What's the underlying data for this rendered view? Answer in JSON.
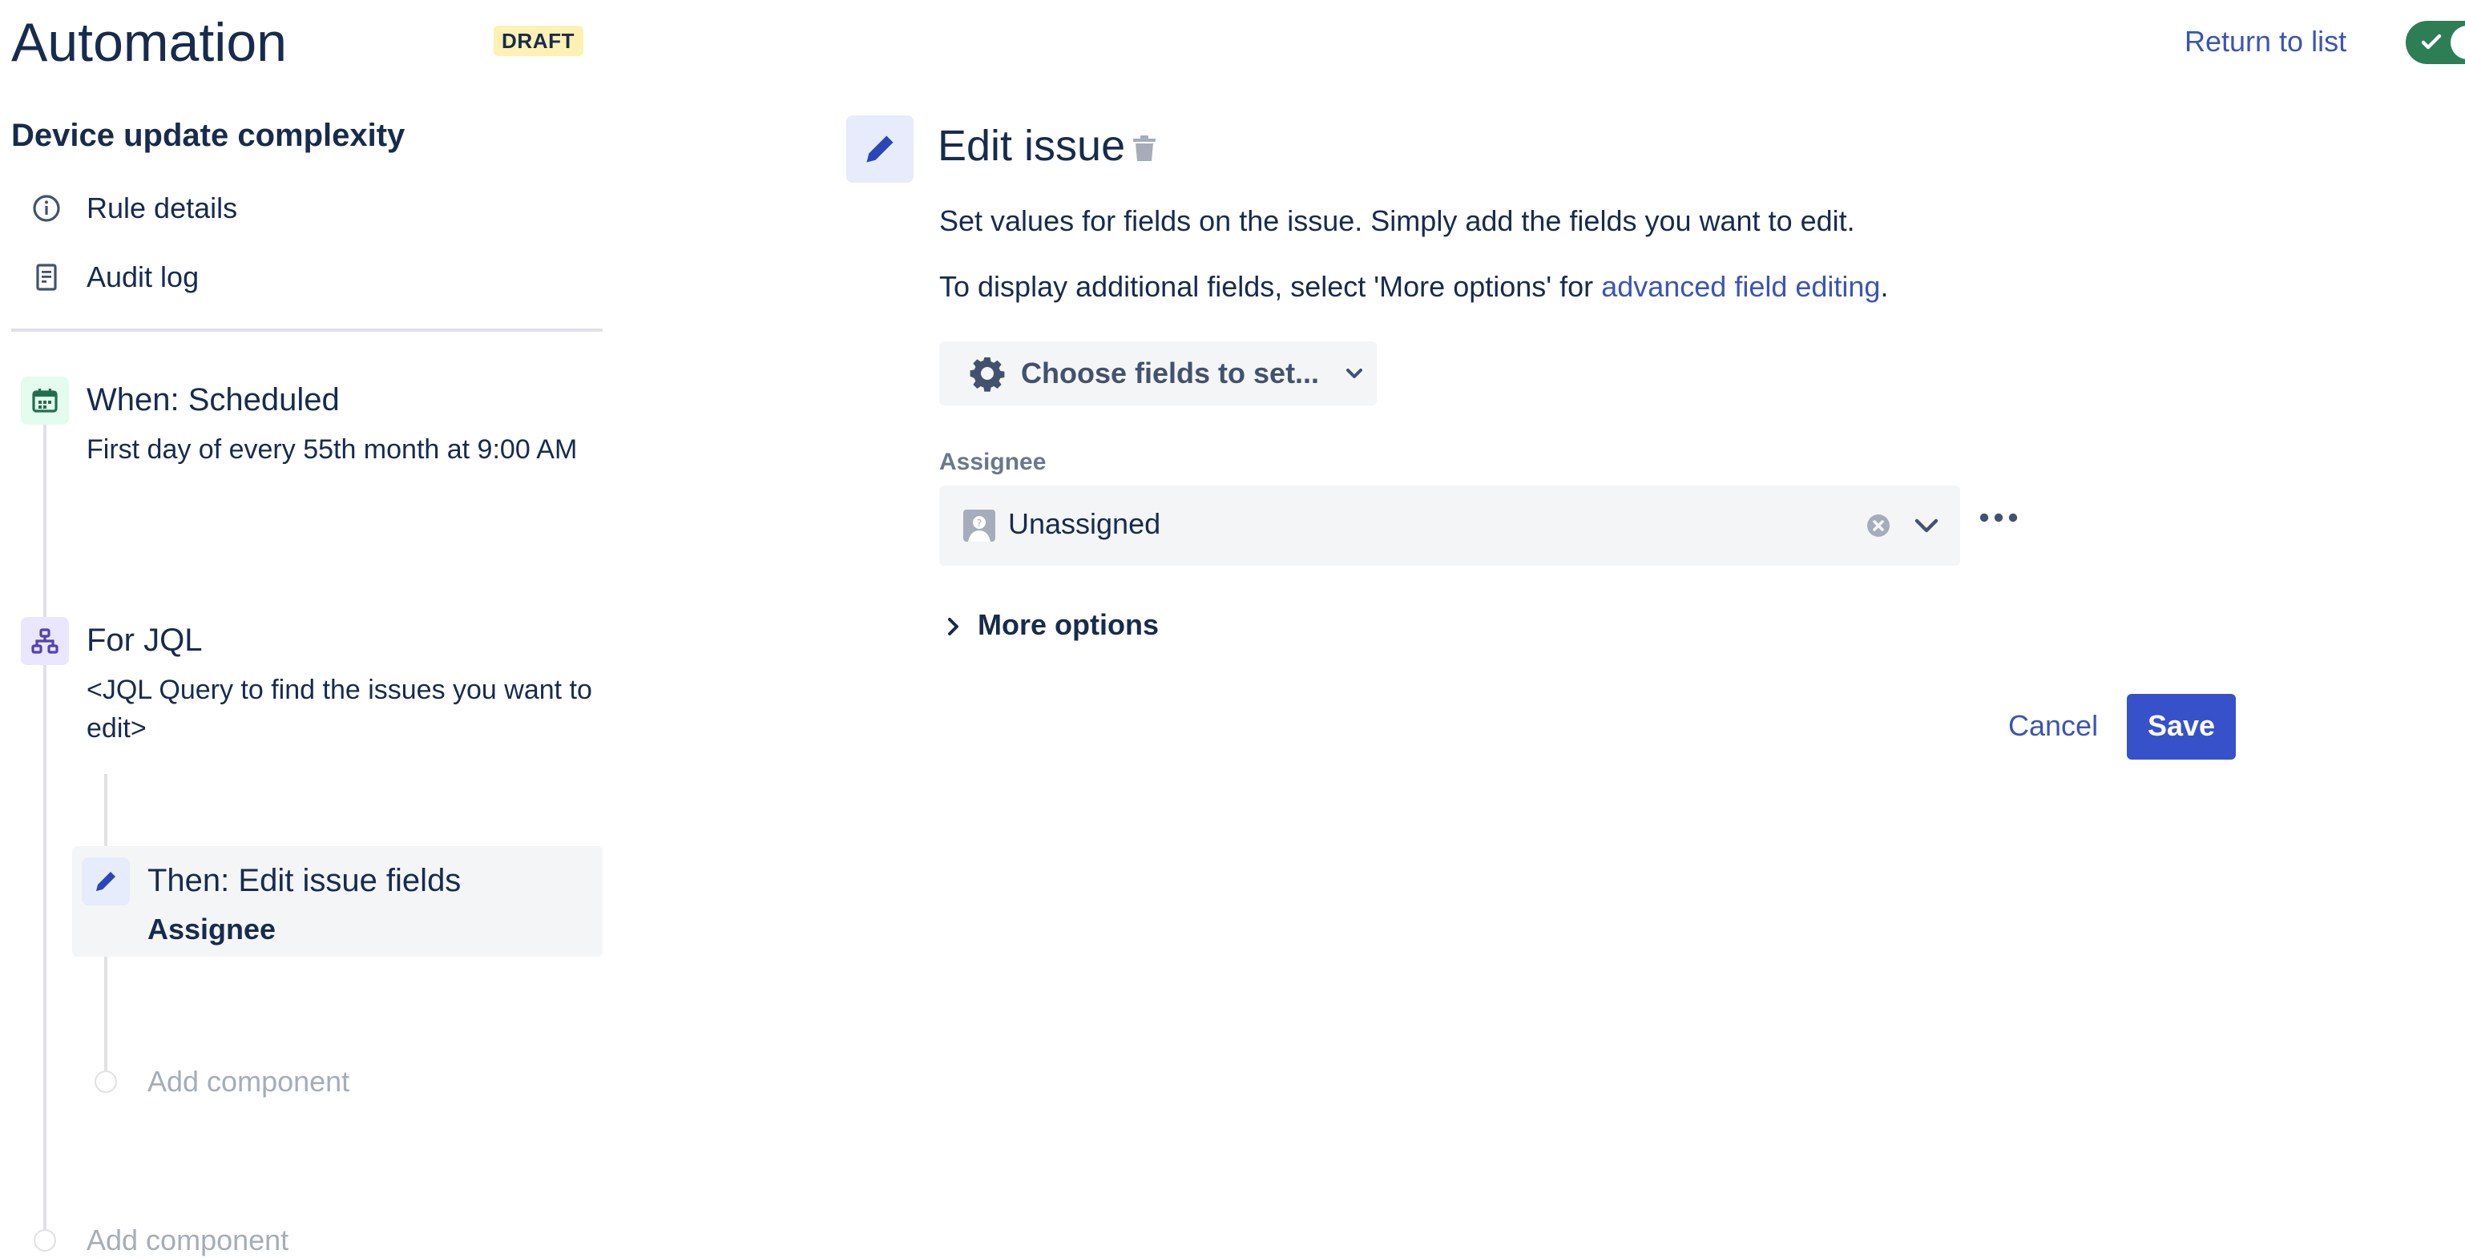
{
  "header": {
    "title": "Automation",
    "status_badge": "DRAFT",
    "return_link": "Return to list",
    "rule_enabled": true
  },
  "sidebar": {
    "rule_name": "Device update complexity",
    "nav": [
      {
        "label": "Rule details",
        "icon": "info-icon"
      },
      {
        "label": "Audit log",
        "icon": "document-icon"
      }
    ],
    "steps": {
      "trigger": {
        "title": "When: Scheduled",
        "description": "First day of every 55th month at 9:00 AM",
        "icon": "calendar-icon"
      },
      "branch": {
        "title": "For JQL",
        "description": "<JQL Query to find the issues you want to edit>",
        "icon": "branch-icon"
      },
      "action": {
        "title": "Then: Edit issue fields",
        "detail": "Assignee",
        "icon": "pencil-icon"
      },
      "add_inner": "Add component",
      "add_outer": "Add component"
    }
  },
  "editor": {
    "title": "Edit issue",
    "intro": "Set values for fields on the issue. Simply add the fields you want to edit.",
    "advanced_prefix": "To display additional fields, select 'More options' for ",
    "advanced_link": "advanced field editing",
    "advanced_suffix": ".",
    "choose_fields": "Choose fields to set...",
    "field_label": "Assignee",
    "field_value": "Unassigned",
    "more_options": "More options",
    "cancel": "Cancel",
    "save": "Save"
  },
  "colors": {
    "accent": "#3651c9",
    "link": "#3b55b3",
    "toggle_on": "#2d7d55",
    "draft_bg": "#fff0b3"
  }
}
